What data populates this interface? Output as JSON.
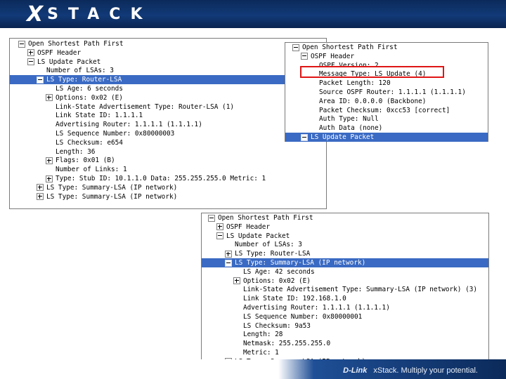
{
  "header": {
    "logo_x": "X",
    "logo_rest": "STACK"
  },
  "footer": {
    "brand": "D-Link",
    "tagline": "xStack. Multiply your potential."
  },
  "panel1": {
    "rows": [
      {
        "text": "Open Shortest Path First",
        "exp": "minus",
        "indent": 0
      },
      {
        "text": "OSPF Header",
        "exp": "plus",
        "indent": 1
      },
      {
        "text": "LS Update Packet",
        "exp": "minus",
        "indent": 1
      },
      {
        "text": "Number of LSAs: 3",
        "exp": "none",
        "indent": 2
      },
      {
        "text": "LS Type: Router-LSA",
        "exp": "minus",
        "indent": 2,
        "selected": true
      },
      {
        "text": "LS Age: 6 seconds",
        "exp": "none",
        "indent": 3
      },
      {
        "text": "Options: 0x02 (E)",
        "exp": "plus",
        "indent": 3
      },
      {
        "text": "Link-State Advertisement Type: Router-LSA (1)",
        "exp": "none",
        "indent": 3
      },
      {
        "text": "Link State ID: 1.1.1.1",
        "exp": "none",
        "indent": 3
      },
      {
        "text": "Advertising Router: 1.1.1.1 (1.1.1.1)",
        "exp": "none",
        "indent": 3
      },
      {
        "text": "LS Sequence Number: 0x80000003",
        "exp": "none",
        "indent": 3
      },
      {
        "text": "LS Checksum: e654",
        "exp": "none",
        "indent": 3
      },
      {
        "text": "Length: 36",
        "exp": "none",
        "indent": 3
      },
      {
        "text": "Flags: 0x01 (B)",
        "exp": "plus",
        "indent": 3
      },
      {
        "text": "Number of Links: 1",
        "exp": "none",
        "indent": 3
      },
      {
        "text": "Type: Stub     ID: 10.1.1.0        Data: 255.255.255.0     Metric: 1",
        "exp": "plus",
        "indent": 3
      },
      {
        "text": "LS Type: Summary-LSA (IP network)",
        "exp": "plus",
        "indent": 2
      },
      {
        "text": "LS Type: Summary-LSA (IP network)",
        "exp": "plus",
        "indent": 2
      }
    ]
  },
  "panel2": {
    "rows": [
      {
        "text": "Open Shortest Path First",
        "exp": "minus",
        "indent": 0
      },
      {
        "text": "OSPF Header",
        "exp": "minus",
        "indent": 1
      },
      {
        "text": "OSPF Version: 2",
        "exp": "none",
        "indent": 2
      },
      {
        "text": "Message Type: LS Update (4)",
        "exp": "none",
        "indent": 2
      },
      {
        "text": "Packet Length: 120",
        "exp": "none",
        "indent": 2
      },
      {
        "text": "Source OSPF Router: 1.1.1.1 (1.1.1.1)",
        "exp": "none",
        "indent": 2
      },
      {
        "text": "Area ID: 0.0.0.0 (Backbone)",
        "exp": "none",
        "indent": 2
      },
      {
        "text": "Packet Checksum: 0xcc53 [correct]",
        "exp": "none",
        "indent": 2
      },
      {
        "text": "Auth Type: Null",
        "exp": "none",
        "indent": 2
      },
      {
        "text": "Auth Data (none)",
        "exp": "none",
        "indent": 2
      },
      {
        "text": "LS Update Packet",
        "exp": "minus",
        "indent": 1,
        "selected": true
      }
    ]
  },
  "panel3": {
    "rows": [
      {
        "text": "Open Shortest Path First",
        "exp": "minus",
        "indent": 0
      },
      {
        "text": "OSPF Header",
        "exp": "plus",
        "indent": 1
      },
      {
        "text": "LS Update Packet",
        "exp": "minus",
        "indent": 1
      },
      {
        "text": "Number of LSAs: 3",
        "exp": "none",
        "indent": 2
      },
      {
        "text": "LS Type: Router-LSA",
        "exp": "plus",
        "indent": 2
      },
      {
        "text": "LS Type: Summary-LSA (IP network)",
        "exp": "minus",
        "indent": 2,
        "selected": true
      },
      {
        "text": "LS Age: 42 seconds",
        "exp": "none",
        "indent": 3
      },
      {
        "text": "Options: 0x02 (E)",
        "exp": "plus",
        "indent": 3
      },
      {
        "text": "Link-State Advertisement Type: Summary-LSA (IP network) (3)",
        "exp": "none",
        "indent": 3
      },
      {
        "text": "Link State ID: 192.168.1.0",
        "exp": "none",
        "indent": 3
      },
      {
        "text": "Advertising Router: 1.1.1.1 (1.1.1.1)",
        "exp": "none",
        "indent": 3
      },
      {
        "text": "LS Sequence Number: 0x80000001",
        "exp": "none",
        "indent": 3
      },
      {
        "text": "LS Checksum: 9a53",
        "exp": "none",
        "indent": 3
      },
      {
        "text": "Length: 28",
        "exp": "none",
        "indent": 3
      },
      {
        "text": "Netmask: 255.255.255.0",
        "exp": "none",
        "indent": 3
      },
      {
        "text": "Metric: 1",
        "exp": "none",
        "indent": 3
      },
      {
        "text": "LS Type: Summary-LSA (IP network)",
        "exp": "plus",
        "indent": 2
      }
    ]
  }
}
